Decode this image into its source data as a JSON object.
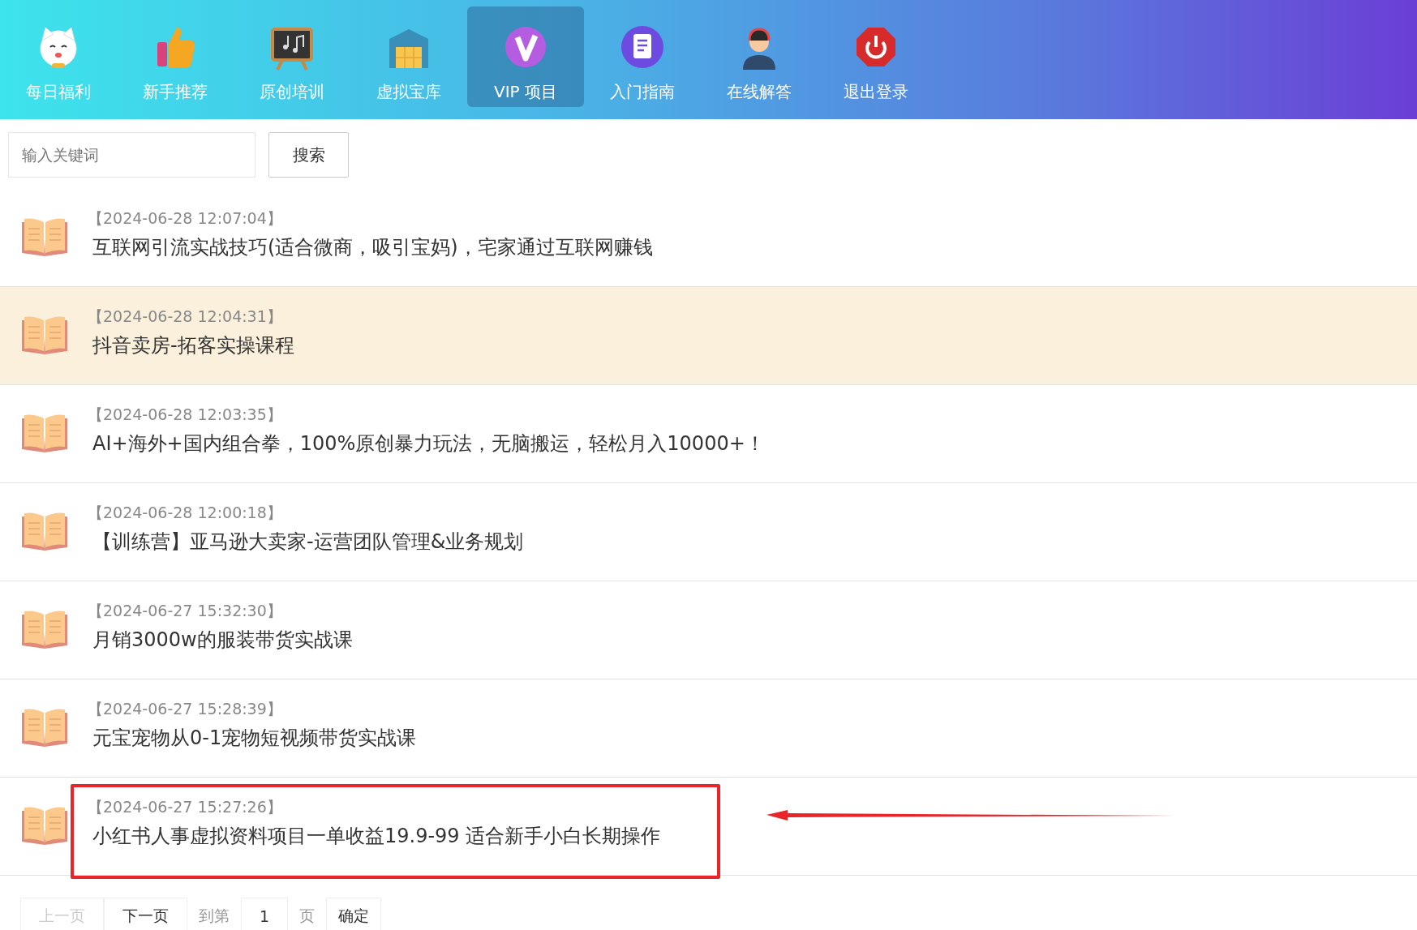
{
  "nav": {
    "items": [
      {
        "label": "每日福利",
        "selected": false
      },
      {
        "label": "新手推荐",
        "selected": false
      },
      {
        "label": "原创培训",
        "selected": false
      },
      {
        "label": "虚拟宝库",
        "selected": false
      },
      {
        "label": "VIP 项目",
        "selected": true
      },
      {
        "label": "入门指南",
        "selected": false
      },
      {
        "label": "在线解答",
        "selected": false
      },
      {
        "label": "退出登录",
        "selected": false
      }
    ]
  },
  "search": {
    "placeholder": "输入关键词",
    "button": "搜索"
  },
  "articles": [
    {
      "date": "【2024-06-28 12:07:04】",
      "title": "互联网引流实战技巧(适合微商，吸引宝妈)，宅家通过互联网赚钱",
      "highlighted": false,
      "annotated": false
    },
    {
      "date": "【2024-06-28 12:04:31】",
      "title": "抖音卖房-拓客实操课程",
      "highlighted": true,
      "annotated": false
    },
    {
      "date": "【2024-06-28 12:03:35】",
      "title": "AI+海外+国内组合拳，100%原创暴力玩法，无脑搬运，轻松月入10000+！",
      "highlighted": false,
      "annotated": false
    },
    {
      "date": "【2024-06-28 12:00:18】",
      "title": "【训练营】亚马逊大卖家-运营团队管理&业务规划",
      "highlighted": false,
      "annotated": false
    },
    {
      "date": "【2024-06-27 15:32:30】",
      "title": "月销3000w的服装带货实战课",
      "highlighted": false,
      "annotated": false
    },
    {
      "date": "【2024-06-27 15:28:39】",
      "title": "元宝宠物从0-1宠物短视频带货实战课",
      "highlighted": false,
      "annotated": false
    },
    {
      "date": "【2024-06-27 15:27:26】",
      "title": "小红书人事虚拟资料项目一单收益19.9-99 适合新手小白长期操作",
      "highlighted": false,
      "annotated": true
    }
  ],
  "pagination": {
    "prev": {
      "label": "上一页",
      "disabled": true
    },
    "next": {
      "label": "下一页",
      "disabled": false
    },
    "goto_label": "到第",
    "page_value": "1",
    "page_label": "页",
    "confirm": "确定"
  }
}
